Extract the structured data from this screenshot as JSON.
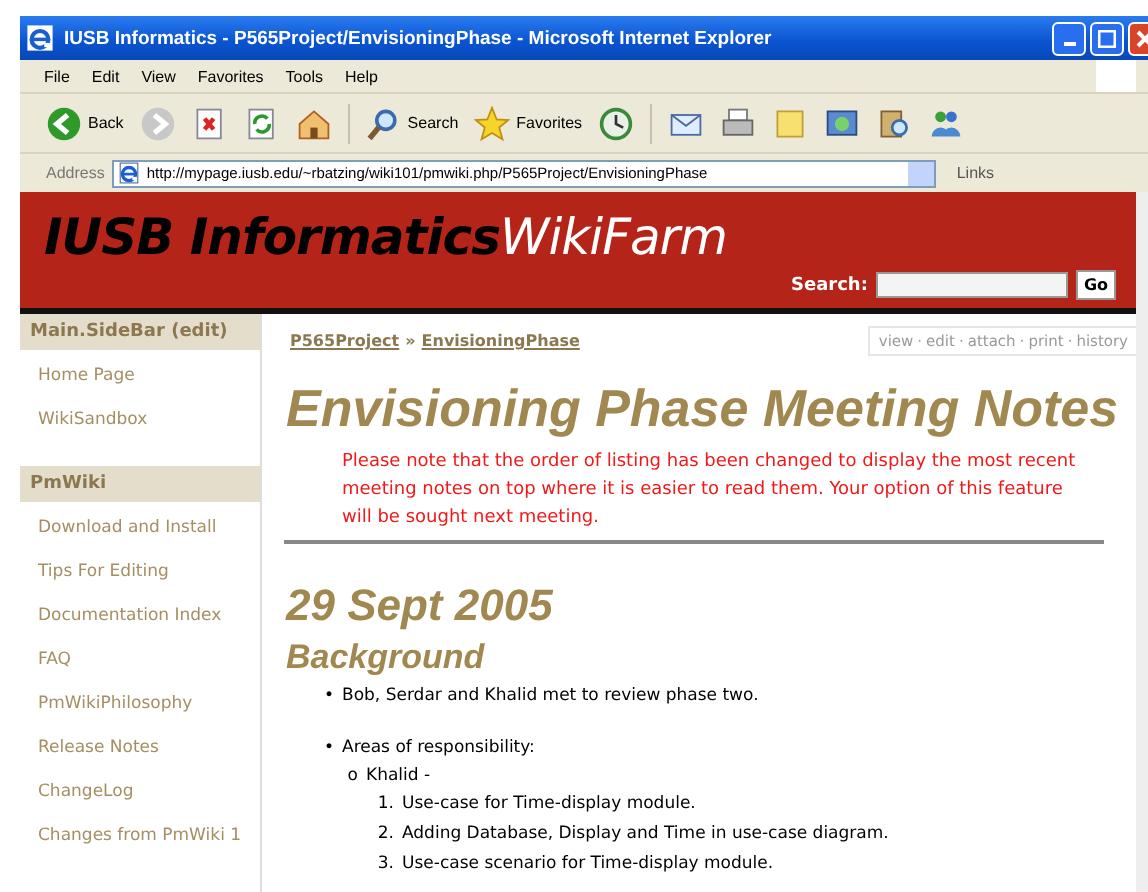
{
  "window": {
    "title": "IUSB Informatics - P565Project/EnvisioningPhase - Microsoft Internet Explorer"
  },
  "menu": [
    "File",
    "Edit",
    "View",
    "Favorites",
    "Tools",
    "Help"
  ],
  "toolbar": [
    {
      "kind": "back",
      "label": "Back"
    },
    {
      "kind": "forward"
    },
    {
      "kind": "stop"
    },
    {
      "kind": "refresh"
    },
    {
      "kind": "home"
    },
    {
      "kind": "search",
      "label": "Search"
    },
    {
      "kind": "favorites",
      "label": "Favorites"
    },
    {
      "kind": "history"
    },
    {
      "kind": "mail"
    },
    {
      "kind": "print"
    },
    {
      "kind": "note"
    },
    {
      "kind": "media"
    },
    {
      "kind": "research"
    },
    {
      "kind": "messenger"
    }
  ],
  "address": {
    "label": "Address",
    "value": "http://mypage.iusb.edu/~rbatzing/wiki101/pmwiki.php/P565Project/EnvisioningPhase",
    "links": "Links"
  },
  "header": {
    "logo_bold": "IUSB Informatics",
    "logo_light": "WikiFarm",
    "search_label": "Search:",
    "go": "Go"
  },
  "sidebar": [
    {
      "title": "Main.SideBar",
      "edit_open": "(",
      "edit": "edit",
      "edit_close": ")",
      "items": [
        "Home Page",
        "WikiSandbox"
      ]
    },
    {
      "title": "PmWiki",
      "items": [
        "Download and Install",
        "Tips For Editing",
        "Documentation Index",
        "FAQ",
        "PmWikiPhilosophy",
        "Release Notes",
        "ChangeLog",
        "Changes from PmWiki 1"
      ]
    }
  ],
  "breadcrumb": {
    "parts": [
      "P565Project",
      "EnvisioningPhase"
    ],
    "separator": "»"
  },
  "actions": {
    "items": [
      "view",
      "edit",
      "attach",
      "print",
      "history"
    ],
    "separator": "·"
  },
  "page_title": "Envisioning Phase Meeting Notes",
  "note": "Please note that the order of listing has been changed to display the most recent meeting notes on top where it is easier to read them. Your option of this feature will be sought next meeting.",
  "date_heading": "29 Sept 2005",
  "section_heading": "Background",
  "list": [
    {
      "marker": "•",
      "text": "Bob, Serdar and Khalid met to review phase two."
    },
    {
      "marker": "•",
      "text": "Areas of responsibility:",
      "children": [
        {
          "marker": "o",
          "text": "Khalid -",
          "children": [
            {
              "marker": "1.",
              "text": "Use-case for Time-display module."
            },
            {
              "marker": "2.",
              "text": "Adding Database, Display and Time in use-case diagram."
            },
            {
              "marker": "3.",
              "text": "Use-case scenario for Time-display module."
            }
          ]
        }
      ]
    }
  ]
}
